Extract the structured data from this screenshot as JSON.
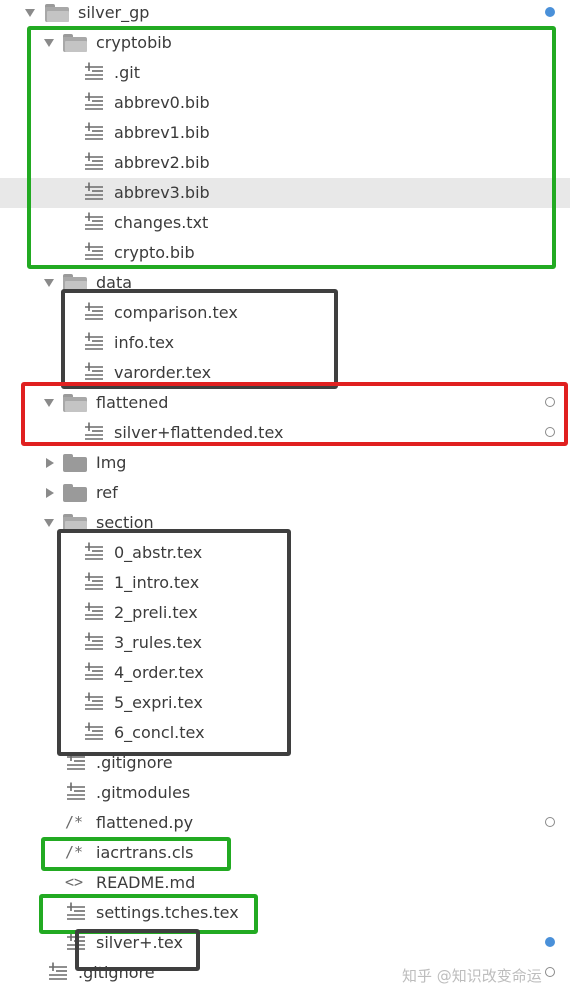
{
  "tree": [
    {
      "label": "silver_gp",
      "kind": "folder",
      "open": true,
      "indent": 0,
      "status": "dot-filled"
    },
    {
      "label": "cryptobib",
      "kind": "folder",
      "open": true,
      "indent": 1
    },
    {
      "label": ".git",
      "kind": "file",
      "indent": 2
    },
    {
      "label": "abbrev0.bib",
      "kind": "file",
      "indent": 2
    },
    {
      "label": "abbrev1.bib",
      "kind": "file",
      "indent": 2
    },
    {
      "label": "abbrev2.bib",
      "kind": "file",
      "indent": 2
    },
    {
      "label": "abbrev3.bib",
      "kind": "file",
      "indent": 2,
      "highlighted": true
    },
    {
      "label": "changes.txt",
      "kind": "file",
      "indent": 2
    },
    {
      "label": "crypto.bib",
      "kind": "file",
      "indent": 2
    },
    {
      "label": "data",
      "kind": "folder",
      "open": true,
      "indent": 1
    },
    {
      "label": "comparison.tex",
      "kind": "file",
      "indent": 2
    },
    {
      "label": "info.tex",
      "kind": "file",
      "indent": 2
    },
    {
      "label": "varorder.tex",
      "kind": "file",
      "indent": 2
    },
    {
      "label": "flattened",
      "kind": "folder",
      "open": true,
      "indent": 1,
      "status": "dot-hollow"
    },
    {
      "label": "silver+flattended.tex",
      "kind": "file",
      "indent": 2,
      "status": "dot-hollow"
    },
    {
      "label": "Img",
      "kind": "folder",
      "open": false,
      "indent": 1
    },
    {
      "label": "ref",
      "kind": "folder",
      "open": false,
      "indent": 1
    },
    {
      "label": "section",
      "kind": "folder",
      "open": true,
      "indent": 1
    },
    {
      "label": "0_abstr.tex",
      "kind": "file",
      "indent": 2
    },
    {
      "label": "1_intro.tex",
      "kind": "file",
      "indent": 2
    },
    {
      "label": "2_preli.tex",
      "kind": "file",
      "indent": 2
    },
    {
      "label": "3_rules.tex",
      "kind": "file",
      "indent": 2
    },
    {
      "label": "4_order.tex",
      "kind": "file",
      "indent": 2
    },
    {
      "label": "5_expri.tex",
      "kind": "file",
      "indent": 2
    },
    {
      "label": "6_concl.tex",
      "kind": "file",
      "indent": 2
    },
    {
      "label": ".gitignore",
      "kind": "file",
      "indent": 1
    },
    {
      "label": ".gitmodules",
      "kind": "file",
      "indent": 1
    },
    {
      "label": "flattened.py",
      "kind": "comment-file",
      "indent": 1,
      "status": "dot-hollow"
    },
    {
      "label": "iacrtrans.cls",
      "kind": "comment-file",
      "indent": 1
    },
    {
      "label": "README.md",
      "kind": "code-file",
      "indent": 1
    },
    {
      "label": "settings.tches.tex",
      "kind": "file",
      "indent": 1
    },
    {
      "label": "silver+.tex",
      "kind": "file",
      "indent": 1,
      "status": "dot-filled"
    },
    {
      "label": ".gitignore",
      "kind": "file",
      "indent": 0,
      "status": "dot-hollow"
    }
  ],
  "icons": {
    "file": "text-file-icon",
    "comment-file": "comment-file-icon",
    "code-file": "code-file-icon",
    "folder-open": "folder-open-icon",
    "folder-closed": "folder-closed-icon"
  },
  "colors": {
    "annotation_green": "#22aa22",
    "annotation_dark": "#3f3f3f",
    "annotation_red": "#e02020",
    "status_dot": "#4a90d9"
  },
  "watermark": "知乎 @知识改变命运"
}
